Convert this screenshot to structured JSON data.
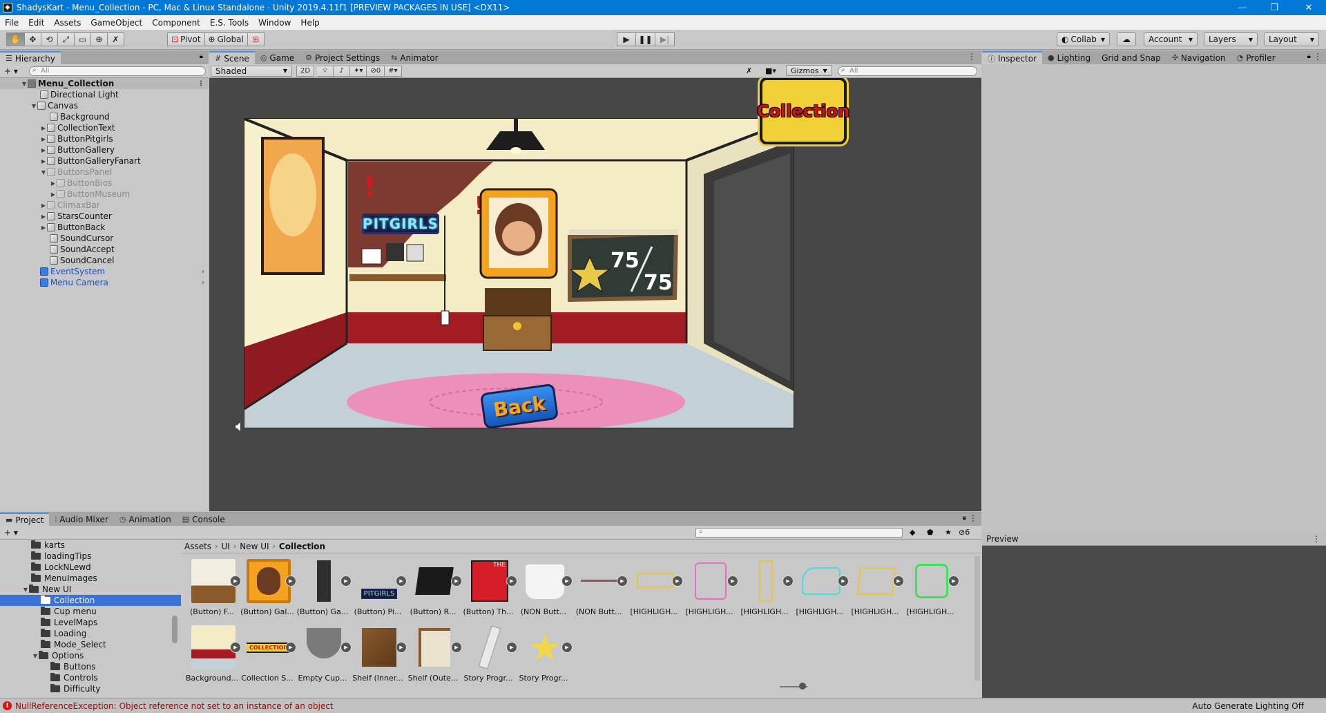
{
  "titlebar": {
    "title": "ShadysKart - Menu_Collection - PC, Mac & Linux Standalone - Unity 2019.4.11f1 [PREVIEW PACKAGES IN USE] <DX11>",
    "minimize": "—",
    "maximize": "❐",
    "close": "✕"
  },
  "menu": [
    "File",
    "Edit",
    "Assets",
    "GameObject",
    "Component",
    "E.S. Tools",
    "Window",
    "Help"
  ],
  "toolbar": {
    "tools": [
      "✋",
      "✥",
      "⟲",
      "⤢",
      "▭",
      "⊕",
      "✗"
    ],
    "pivot": "Pivot",
    "global": "Global",
    "play": "▶",
    "pause": "❚❚",
    "step": "▶|",
    "collab": "Collab",
    "cloud": "☁",
    "account": "Account",
    "layers": "Layers",
    "layout": "Layout"
  },
  "hierarchy": {
    "tab": "Hierarchy",
    "add": "+ ▾",
    "search_placeholder": "All",
    "scene": "Menu_Collection",
    "items": [
      {
        "label": "Directional Light"
      },
      {
        "label": "Canvas"
      },
      {
        "label": "Background"
      },
      {
        "label": "CollectionText"
      },
      {
        "label": "ButtonPitgirls"
      },
      {
        "label": "ButtonGallery"
      },
      {
        "label": "ButtonGalleryFanart"
      },
      {
        "label": "ButtonsPanel"
      },
      {
        "label": "ButtonBios"
      },
      {
        "label": "ButtonMuseum"
      },
      {
        "label": "ClimaxBar"
      },
      {
        "label": "StarsCounter"
      },
      {
        "label": "ButtonBack"
      },
      {
        "label": "SoundCursor"
      },
      {
        "label": "SoundAccept"
      },
      {
        "label": "SoundCancel"
      },
      {
        "label": "EventSystem"
      },
      {
        "label": "Menu Camera"
      }
    ]
  },
  "scene": {
    "tabs": [
      "Scene",
      "Game",
      "Project Settings",
      "Animator"
    ],
    "shading": "Shaded",
    "mode2d": "2D",
    "hidden_count": "0",
    "gizmos": "Gizmos",
    "search_placeholder": "All",
    "game": {
      "sign": "Collection",
      "neon": "PITGIRLS",
      "stars_current": "75",
      "stars_total": "75",
      "back_button": "Back"
    }
  },
  "inspector": {
    "tabs": [
      "Inspector",
      "Lighting",
      "Grid and Snap",
      "Navigation",
      "Profiler"
    ],
    "preview_label": "Preview"
  },
  "project": {
    "tabs": [
      "Project",
      "Audio Mixer",
      "Animation",
      "Console"
    ],
    "add": "+ ▾",
    "hidden_count": "6",
    "tree": [
      {
        "label": "karts"
      },
      {
        "label": "loadingTips"
      },
      {
        "label": "LockNLewd"
      },
      {
        "label": "MenuImages"
      },
      {
        "label": "New UI"
      },
      {
        "label": "Collection"
      },
      {
        "label": "Cup menu"
      },
      {
        "label": "LevelMaps"
      },
      {
        "label": "Loading"
      },
      {
        "label": "Mode_Select"
      },
      {
        "label": "Options"
      },
      {
        "label": "Buttons"
      },
      {
        "label": "Controls"
      },
      {
        "label": "Difficulty"
      }
    ],
    "breadcrumb": [
      "Assets",
      "UI",
      "New UI",
      "Collection"
    ],
    "assets": [
      {
        "label": "(Button) F..."
      },
      {
        "label": "(Button) Gal..."
      },
      {
        "label": "(Button) Ga..."
      },
      {
        "label": "(Button) Pi..."
      },
      {
        "label": "(Button) R..."
      },
      {
        "label": "(Button) Th..."
      },
      {
        "label": "(NON Butt..."
      },
      {
        "label": "(NON Butt..."
      },
      {
        "label": "[HIGHLIGH..."
      },
      {
        "label": "[HIGHLIGH..."
      },
      {
        "label": "[HIGHLIGH..."
      },
      {
        "label": "[HIGHLIGH..."
      },
      {
        "label": "[HIGHLIGH..."
      },
      {
        "label": "[HIGHLIGH..."
      },
      {
        "label": "Background..."
      },
      {
        "label": "Collection S..."
      },
      {
        "label": "Empty Cup..."
      },
      {
        "label": "Shelf (Inner..."
      },
      {
        "label": "Shelf (Oute..."
      },
      {
        "label": "Story Progr..."
      },
      {
        "label": "Story Progr..."
      }
    ],
    "asset_thumb_text": {
      "pitgirls": "PITGIRLS",
      "collection": "COLLECTION",
      "book": "THE"
    }
  },
  "status": {
    "error": "NullReferenceException: Object reference not set to an instance of an object",
    "right": "Auto Generate Lighting Off"
  },
  "colors": {
    "titlebar": "#0078d7",
    "selection": "#3a72d8",
    "error": "#b00000"
  }
}
